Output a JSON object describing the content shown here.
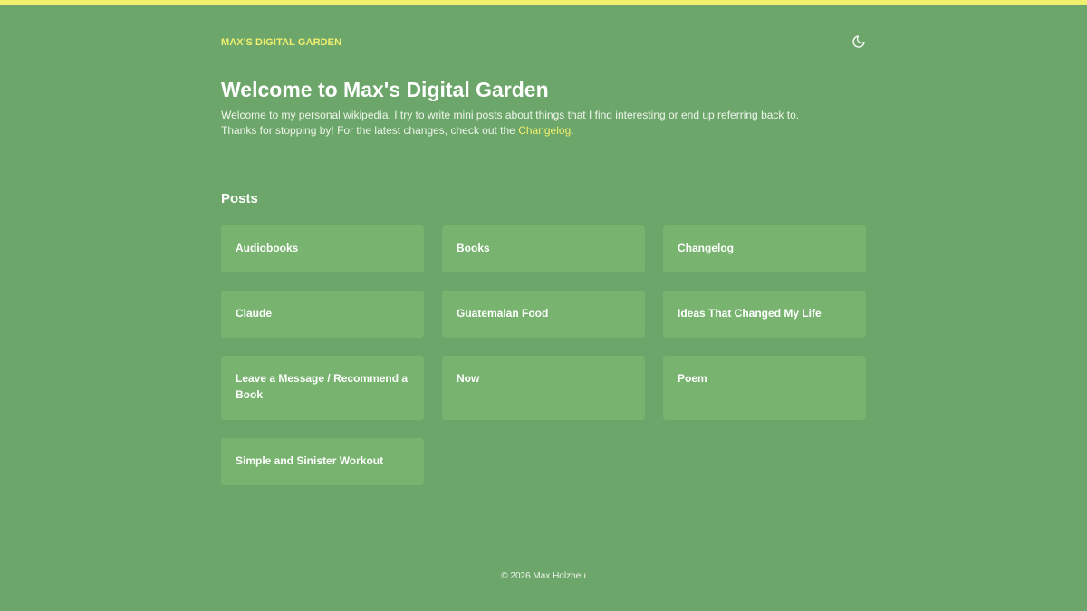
{
  "header": {
    "site_title": "MAX'S DIGITAL GARDEN",
    "theme_toggle_icon": "moon-icon"
  },
  "hero": {
    "title": "Welcome to Max's Digital Garden",
    "intro_line1": "Welcome to my personal wikipedia. I try to write mini posts about things that I find interesting or end up referring back to.",
    "intro_line2_prefix": "Thanks for stopping by! For the latest changes, check out the ",
    "intro_link": "Changelog",
    "intro_line2_suffix": "."
  },
  "posts": {
    "heading": "Posts",
    "items": [
      {
        "title": "Audiobooks"
      },
      {
        "title": "Books"
      },
      {
        "title": "Changelog"
      },
      {
        "title": "Claude"
      },
      {
        "title": "Guatemalan Food"
      },
      {
        "title": "Ideas That Changed My Life"
      },
      {
        "title": "Leave a Message / Recommend a Book"
      },
      {
        "title": "Now"
      },
      {
        "title": "Poem"
      },
      {
        "title": "Simple and Sinister Workout"
      }
    ]
  },
  "footer": {
    "copyright": "© 2026 Max Holzheu"
  },
  "colors": {
    "background": "#6da66a",
    "accent": "#f1f06e",
    "card": "#78b470"
  }
}
